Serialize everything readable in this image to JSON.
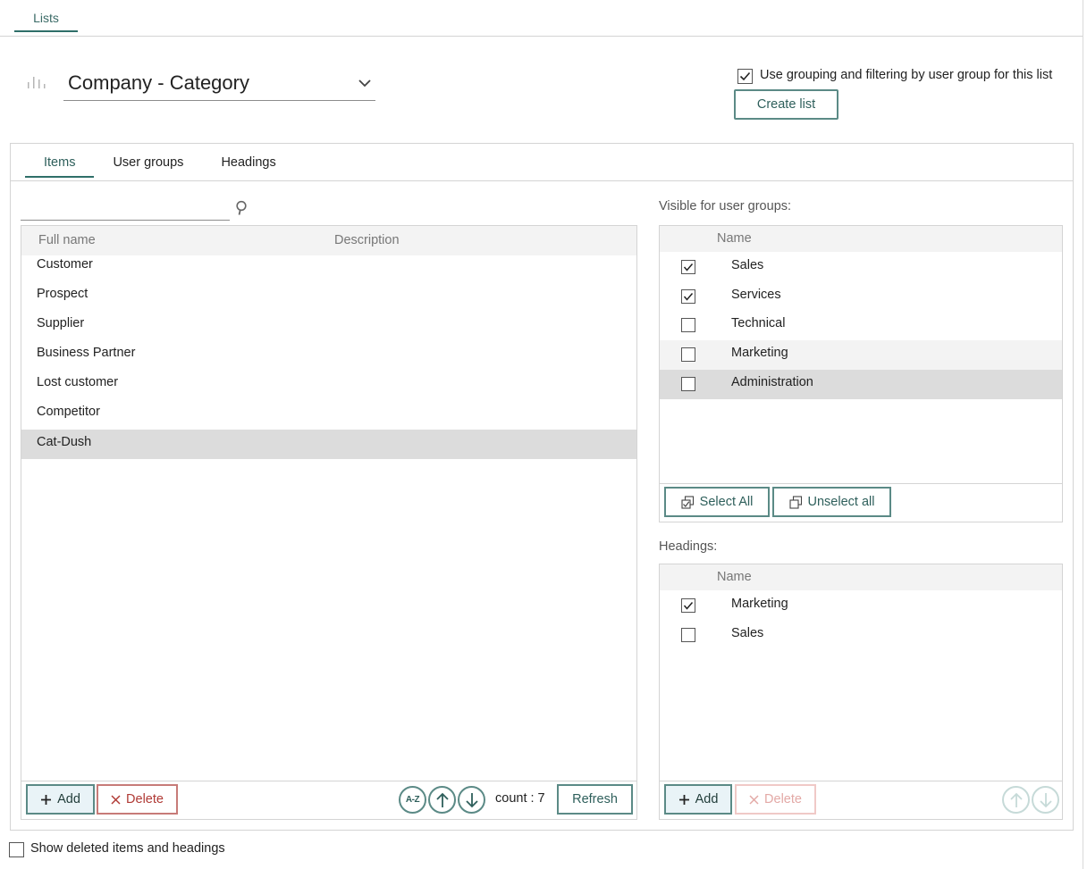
{
  "top_tabs": [
    {
      "label": "Lists",
      "active": true
    }
  ],
  "list_selector": {
    "value": "Company - Category"
  },
  "grouping_option": {
    "label": "Use grouping and filtering by user group for this list",
    "checked": true
  },
  "create_list_label": "Create list",
  "tabs": [
    {
      "label": "Items",
      "active": true
    },
    {
      "label": "User groups",
      "active": false
    },
    {
      "label": "Headings",
      "active": false
    }
  ],
  "search": {
    "value": "",
    "placeholder": ""
  },
  "items_table": {
    "columns": [
      "Full name",
      "Description"
    ],
    "rows": [
      {
        "full_name": "Customer",
        "description": ""
      },
      {
        "full_name": "Prospect",
        "description": ""
      },
      {
        "full_name": "Supplier",
        "description": ""
      },
      {
        "full_name": "Business Partner",
        "description": ""
      },
      {
        "full_name": "Lost customer",
        "description": ""
      },
      {
        "full_name": "Competitor",
        "description": ""
      },
      {
        "full_name": "Cat-Dush",
        "description": "",
        "selected": true
      }
    ]
  },
  "items_footer": {
    "add_label": "Add",
    "delete_label": "Delete",
    "sort_label": "A-Z",
    "count_text": "count : 7",
    "refresh_label": "Refresh"
  },
  "user_groups": {
    "title": "Visible for user groups:",
    "column": "Name",
    "rows": [
      {
        "name": "Sales",
        "checked": true
      },
      {
        "name": "Services",
        "checked": true
      },
      {
        "name": "Technical",
        "checked": false
      },
      {
        "name": "Marketing",
        "checked": false,
        "hover": true
      },
      {
        "name": "Administration",
        "checked": false,
        "selected": true
      }
    ],
    "select_all_label": "Select All",
    "unselect_all_label": "Unselect all"
  },
  "headings": {
    "title": "Headings:",
    "column": "Name",
    "rows": [
      {
        "name": "Marketing",
        "checked": true
      },
      {
        "name": "Sales",
        "checked": false
      }
    ],
    "add_label": "Add",
    "delete_label": "Delete"
  },
  "show_deleted": {
    "label": "Show deleted items and headings",
    "checked": false
  },
  "colors": {
    "accent": "#2f6f69",
    "delete": "#b03a35",
    "selection": "#dcdcdc"
  }
}
